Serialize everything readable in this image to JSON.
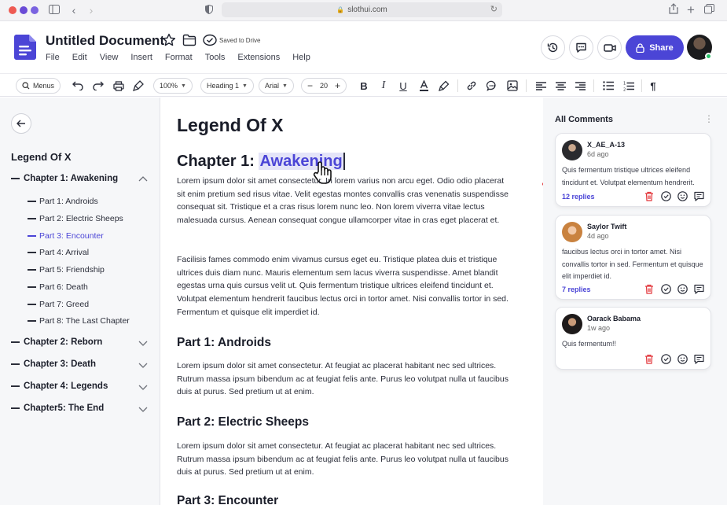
{
  "browser": {
    "url": "slothui.com"
  },
  "app": {
    "title": "Untitled Document",
    "saved_status": "Saved to Drive",
    "menu": [
      "File",
      "Edit",
      "View",
      "Insert",
      "Format",
      "Tools",
      "Extensions",
      "Help"
    ],
    "share_label": "Share"
  },
  "toolbar": {
    "menus_label": "Menus",
    "zoom": "100%",
    "style": "Heading 1",
    "font": "Arial",
    "font_size": "20"
  },
  "sidebar": {
    "doc_title": "Legend Of X",
    "chapters": [
      {
        "label": "Chapter 1: Awakening",
        "expanded": true
      },
      {
        "label": "Chapter 2: Reborn",
        "expanded": false
      },
      {
        "label": "Chapter 3: Death",
        "expanded": false
      },
      {
        "label": "Chapter 4: Legends",
        "expanded": false
      },
      {
        "label": "Chapter5: The End",
        "expanded": false
      }
    ],
    "parts": [
      {
        "label": "Part 1: Androids"
      },
      {
        "label": "Part 2: Electric Sheeps"
      },
      {
        "label": "Part 3: Encounter",
        "active": true
      },
      {
        "label": "Part 4: Arrival"
      },
      {
        "label": "Part 5: Friendship"
      },
      {
        "label": "Part 6: Death"
      },
      {
        "label": "Part 7: Greed"
      },
      {
        "label": "Part 8: The Last Chapter"
      }
    ]
  },
  "document": {
    "title": "Legend Of X",
    "chapter_prefix": "Chapter 1:",
    "chapter_selected_word": "Awakening",
    "para1": "Lorem ipsum dolor sit amet consectetur. In lorem varius non arcu eget. Odio odio placerat sit enim pretium sed risus vitae. Velit egestas montes convallis cras venenatis suspendisse consequat sit. Tristique et a cras risus lorem nunc leo. Non lorem viverra vitae lectus malesuada cursus. Aenean consequat congue ullamcorper vitae in cras eget placerat et.",
    "para2": "Facilisis fames commodo enim vivamus cursus eget eu. Tristique platea duis et tristique ultrices duis diam nunc. Mauris elementum sem lacus viverra suspendisse. Amet blandit egestas urna quis cursus velit ut. Quis fermentum tristique ultrices eleifend tincidunt et. Volutpat elementum hendrerit faucibus lectus orci in tortor amet. Nisi convallis tortor in sed. Fermentum et quisque elit imperdiet id.",
    "part1_heading": "Part 1: Androids",
    "part1_text": "Lorem ipsum dolor sit amet consectetur. At feugiat ac placerat habitant nec sed ultrices. Rutrum massa ipsum bibendum ac at feugiat felis ante. Purus leo volutpat nulla ut faucibus duis at purus. Sed pretium ut at enim.",
    "part2_heading": "Part 2: Electric Sheeps",
    "part2_text": "Lorem ipsum dolor sit amet consectetur. At feugiat ac placerat habitant nec sed ultrices. Rutrum massa ipsum bibendum ac at feugiat felis ante. Purus leo volutpat nulla ut faucibus duis at purus. Sed pretium ut at enim.",
    "part3_heading": "Part 3: Encounter"
  },
  "comments": {
    "title": "All Comments",
    "items": [
      {
        "name": "X_AE_A-13",
        "time": "6d ago",
        "text": "Quis fermentum tristique ultrices eleifend tincidunt et. Volutpat elementum hendrerit.",
        "replies": "12 replies"
      },
      {
        "name": "Saylor Twift",
        "time": "4d ago",
        "text": "faucibus lectus orci in tortor amet. Nisi convallis tortor in sed. Fermentum et quisque elit imperdiet id.",
        "replies": "7 replies"
      },
      {
        "name": "Oarack Babama",
        "time": "1w ago",
        "text": "Quis fermentum!!",
        "replies": ""
      }
    ]
  },
  "colors": {
    "accent": "#4b45d6",
    "delete": "#e2363b",
    "online": "#2bc46a"
  }
}
